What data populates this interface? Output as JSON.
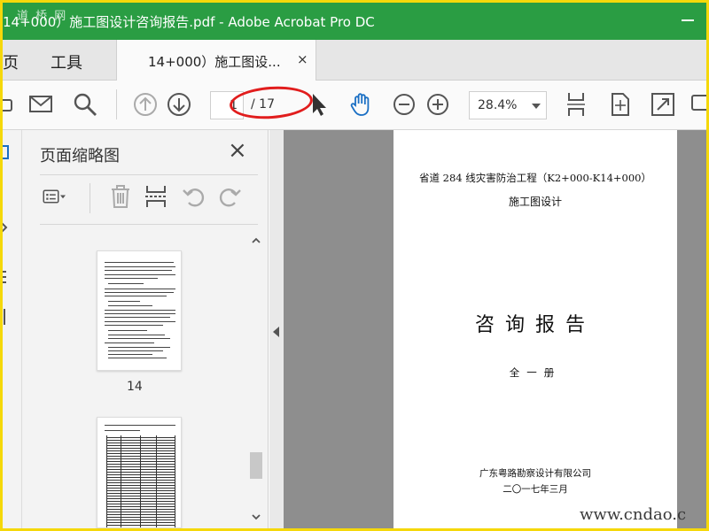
{
  "window": {
    "title": "14+000）施工图设计咨询报告.pdf - Adobe Acrobat Pro DC",
    "watermark_top": "道 桥 网",
    "accent": "#2a9d43"
  },
  "tabs": {
    "home": "主页",
    "tools": "工具",
    "document": "14+000）施工图设...",
    "close": "×"
  },
  "toolbar": {
    "page_current": "1",
    "page_total": "/ 17",
    "zoom": "28.4%",
    "icons": [
      "print-icon",
      "email-icon",
      "search-icon",
      "prev-page-icon",
      "next-page-icon",
      "select-cursor-icon",
      "hand-icon",
      "zoom-out-icon",
      "zoom-in-icon",
      "fit-width-icon",
      "fit-page-icon",
      "fullscreen-icon",
      "comment-icon"
    ]
  },
  "thumbnails": {
    "title": "页面缩略图",
    "close": "×",
    "pages": [
      {
        "label": "14"
      }
    ]
  },
  "document": {
    "line1": "省道 284 线灾害防治工程（K2+000-K14+000）",
    "line2": "施工图设计",
    "line3": "咨询报告",
    "line4": "全一册",
    "line5": "广东粤路勘察设计有限公司",
    "line6": "二〇一七年三月"
  },
  "watermark_bottom": "www.cndao.c"
}
